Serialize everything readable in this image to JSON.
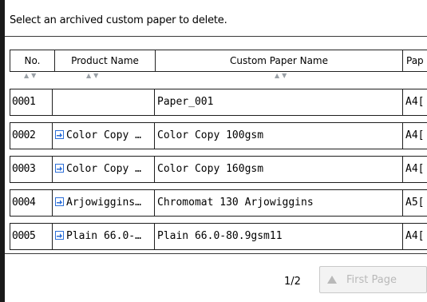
{
  "prompt": "Select an archived custom paper to delete.",
  "headers": {
    "no": "No.",
    "product_name": "Product Name",
    "custom_paper_name": "Custom Paper Name",
    "paper": "Pap"
  },
  "rows": [
    {
      "no": "0001",
      "product": "",
      "custom": "Paper_001",
      "paper": "A4["
    },
    {
      "no": "0002",
      "product": "Color Copy …",
      "custom": "Color Copy 100gsm",
      "paper": "A4["
    },
    {
      "no": "0003",
      "product": "Color Copy …",
      "custom": "Color Copy 160gsm",
      "paper": "A4["
    },
    {
      "no": "0004",
      "product": "Arjowiggins…",
      "custom": "Chromomat 130 Arjowiggins",
      "paper": "A5["
    },
    {
      "no": "0005",
      "product": "Plain 66.0-…",
      "custom": "Plain 66.0-80.9gsm11",
      "paper": "A4["
    }
  ],
  "pager": {
    "current": "1/2",
    "first_page_label": "First Page"
  },
  "icons": {
    "product_icon": "import-arrow-icon",
    "sort_icon": "sort-up-down-icon"
  },
  "colors": {
    "icon_blue": "#2d6fd8",
    "disabled_text": "#b9b9b9"
  }
}
